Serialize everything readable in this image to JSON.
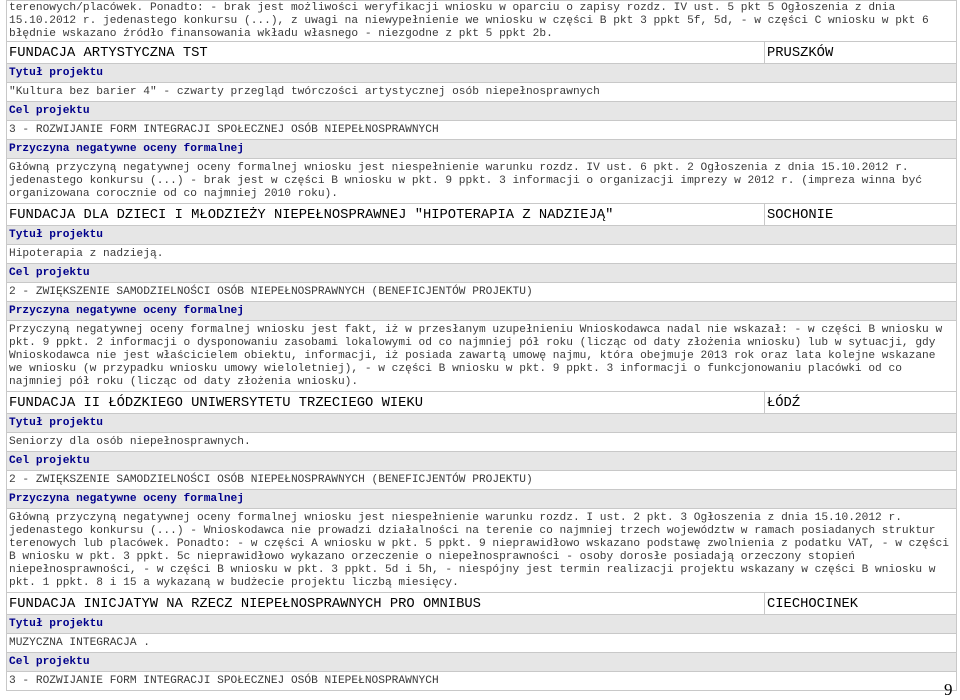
{
  "intro": "terenowych/placówek. Ponadto: - brak jest możliwości weryfikacji wniosku w oparciu o zapisy rozdz. IV ust. 5 pkt 5 Ogłoszenia z dnia 15.10.2012 r. jedenastego konkursu (...), z uwagi na niewypełnienie we wniosku w części B pkt 3 ppkt 5f, 5d, - w części C wniosku w pkt 6 błędnie wskazano źródło finansowania wkładu własnego - niezgodne z pkt 5 ppkt 2b.",
  "labels": {
    "title": "Tytuł projektu",
    "goal": "Cel projektu",
    "reason": "Przyczyna negatywne oceny formalnej"
  },
  "entries": [
    {
      "org": "FUNDACJA ARTYSTYCZNA TST",
      "city": "PRUSZKÓW",
      "title": "\"Kultura bez barier 4\" - czwarty przegląd twórczości artystycznej osób niepełnosprawnych",
      "goal": "3 - ROZWIJANIE FORM INTEGRACJI SPOŁECZNEJ OSÓB NIEPEŁNOSPRAWNYCH",
      "reason": "Główną przyczyną negatywnej oceny formalnej wniosku jest niespełnienie warunku rozdz. IV ust. 6 pkt. 2 Ogłoszenia z dnia 15.10.2012 r. jedenastego konkursu (...) - brak jest w części B wniosku w pkt. 9 ppkt. 3 informacji o organizacji imprezy w 2012 r. (impreza winna być organizowana corocznie od co najmniej 2010 roku)."
    },
    {
      "org": "FUNDACJA DLA DZIECI I MŁODZIEŻY NIEPEŁNOSPRAWNEJ \"HIPOTERAPIA Z NADZIEJĄ\"",
      "city": "SOCHONIE",
      "title": "Hipoterapia z nadzieją.",
      "goal": "2 - ZWIĘKSZENIE SAMODZIELNOŚCI OSÓB NIEPEŁNOSPRAWNYCH (BENEFICJENTÓW PROJEKTU)",
      "reason": "Przyczyną negatywnej oceny formalnej wniosku jest fakt, iż w przesłanym uzupełnieniu Wnioskodawca nadal nie wskazał: - w części B wniosku w pkt. 9 ppkt. 2 informacji o dysponowaniu zasobami lokalowymi od co najmniej pół roku (licząc od daty złożenia wniosku) lub w sytuacji, gdy Wnioskodawca nie jest właścicielem obiektu, informacji, iż posiada zawartą umowę najmu, która obejmuje 2013 rok oraz lata kolejne wskazane we wniosku (w przypadku wniosku umowy wieloletniej), - w części B wniosku w pkt. 9 ppkt. 3 informacji o funkcjonowaniu placówki od co najmniej pół roku (licząc od daty złożenia wniosku)."
    },
    {
      "org": "FUNDACJA II ŁÓDZKIEGO UNIWERSYTETU TRZECIEGO WIEKU",
      "city": "ŁÓDŹ",
      "title": "Seniorzy dla osób niepełnosprawnych.",
      "goal": "2 - ZWIĘKSZENIE SAMODZIELNOŚCI OSÓB NIEPEŁNOSPRAWNYCH (BENEFICJENTÓW PROJEKTU)",
      "reason": "Główną przyczyną negatywnej oceny formalnej wniosku jest niespełnienie warunku rozdz. I ust. 2 pkt. 3 Ogłoszenia z dnia 15.10.2012 r. jedenastego konkursu (...) - Wnioskodawca nie prowadzi działalności na terenie co najmniej trzech województw w ramach posiadanych struktur terenowych lub placówek. Ponadto: - w części A wniosku w pkt. 5 ppkt. 9 nieprawidłowo wskazano podstawę zwolnienia z podatku VAT, - w części B wniosku w pkt. 3 ppkt. 5c nieprawidłowo wykazano orzeczenie o niepełnosprawności - osoby dorosłe posiadają orzeczony stopień niepełnosprawności, - w części B wniosku w pkt. 3 ppkt. 5d i 5h, - niespójny jest termin realizacji projektu wskazany w części B wniosku w pkt. 1 ppkt. 8 i 15 a wykazaną w budżecie projektu liczbą miesięcy."
    },
    {
      "org": "FUNDACJA INICJATYW NA RZECZ NIEPEŁNOSPRAWNYCH PRO OMNIBUS",
      "city": "CIECHOCINEK",
      "title": "MUZYCZNA INTEGRACJA .",
      "goal": "3 - ROZWIJANIE FORM INTEGRACJI SPOŁECZNEJ OSÓB NIEPEŁNOSPRAWNYCH"
    }
  ],
  "page_number": "9"
}
